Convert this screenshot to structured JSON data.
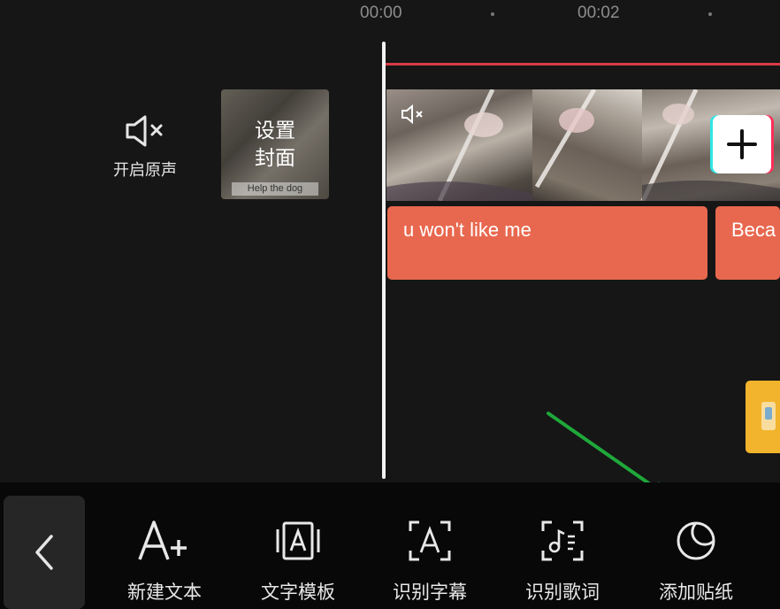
{
  "ruler": {
    "t0": "00:00",
    "t1": "00:02"
  },
  "original_sound": {
    "label": "开启原声"
  },
  "cover": {
    "line1": "设置",
    "line2": "封面",
    "caption": "Help the dog"
  },
  "text_clips": [
    {
      "text": "u won't like me"
    },
    {
      "text": "Beca"
    }
  ],
  "toolbar": {
    "items": [
      {
        "label": "新建文本",
        "icon": "add-text-icon"
      },
      {
        "label": "文字模板",
        "icon": "text-template-icon"
      },
      {
        "label": "识别字幕",
        "icon": "recognize-subtitle-icon"
      },
      {
        "label": "识别歌词",
        "icon": "recognize-lyrics-icon"
      },
      {
        "label": "添加贴纸",
        "icon": "sticker-icon"
      }
    ]
  },
  "colors": {
    "text_clip": "#e8684f",
    "red_line": "#d63b46",
    "arrow": "#1fa83a",
    "sticker_clip": "#f2b42c"
  }
}
